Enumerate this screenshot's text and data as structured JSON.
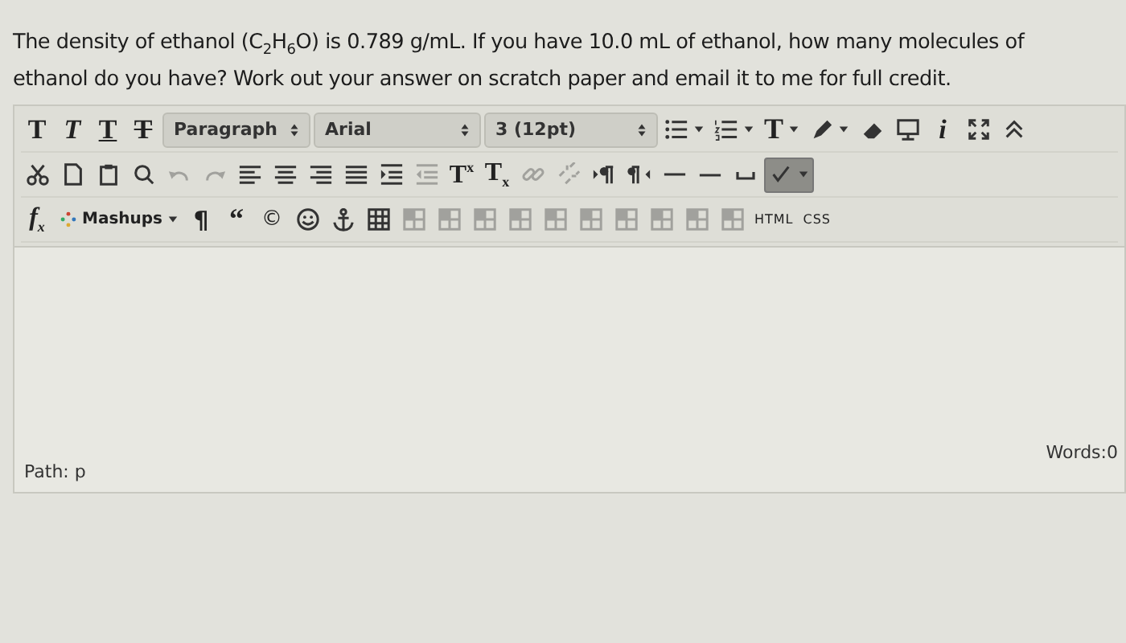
{
  "question": {
    "text": "The density of ethanol (C$_{2}$H$_{6}$O) is 0.789 g/mL.  If you have 10.0 mL of ethanol, how many molecules of ethanol do you have?  Work out your answer on scratch paper and email it to me for full credit."
  },
  "toolbar": {
    "rows": [
      {
        "items": [
          {
            "kind": "bold",
            "label": "T",
            "disabled": false,
            "menu": false
          },
          {
            "kind": "italic",
            "label": "T",
            "disabled": false,
            "menu": false
          },
          {
            "kind": "underline",
            "label": "T",
            "disabled": false,
            "menu": false
          },
          {
            "kind": "strikethrough",
            "label": "T",
            "disabled": false,
            "menu": false
          },
          {
            "kind": "select",
            "label": "Paragraph",
            "disabled": false,
            "menu": false
          },
          {
            "kind": "select",
            "label": "Arial",
            "disabled": false,
            "menu": false
          },
          {
            "kind": "select",
            "label": "3 (12pt)",
            "disabled": false,
            "menu": false
          },
          {
            "kind": "bullet-list",
            "disabled": false,
            "menu": true
          },
          {
            "kind": "numbered-list",
            "disabled": false,
            "menu": true
          },
          {
            "kind": "text-color",
            "label": "T",
            "disabled": false,
            "menu": true
          },
          {
            "kind": "highlighter",
            "disabled": false,
            "menu": true
          },
          {
            "kind": "eraser",
            "disabled": false,
            "menu": false
          },
          {
            "kind": "monitor",
            "disabled": false,
            "menu": false
          },
          {
            "kind": "info",
            "label": "i",
            "disabled": false,
            "menu": false
          },
          {
            "kind": "fullscreen",
            "disabled": false,
            "menu": false
          },
          {
            "kind": "collapse",
            "disabled": false,
            "menu": false
          }
        ]
      },
      {
        "items": [
          {
            "kind": "scissors",
            "disabled": false,
            "menu": false
          },
          {
            "kind": "page",
            "disabled": false,
            "menu": false
          },
          {
            "kind": "clipboard",
            "disabled": false,
            "menu": false
          },
          {
            "kind": "search",
            "disabled": false,
            "menu": false
          },
          {
            "kind": "undo",
            "disabled": true,
            "menu": false
          },
          {
            "kind": "redo",
            "disabled": true,
            "menu": false
          },
          {
            "kind": "align-left",
            "disabled": false,
            "menu": false
          },
          {
            "kind": "align-center",
            "disabled": false,
            "menu": false
          },
          {
            "kind": "align-right",
            "disabled": false,
            "menu": false
          },
          {
            "kind": "align-justify",
            "disabled": false,
            "menu": false
          },
          {
            "kind": "indent",
            "disabled": false,
            "menu": false
          },
          {
            "kind": "outdent",
            "disabled": true,
            "menu": false
          },
          {
            "kind": "superscript",
            "label": "T$^{x}$",
            "disabled": false,
            "menu": false
          },
          {
            "kind": "subscript",
            "label": "T$_{x}$",
            "disabled": false,
            "menu": false
          },
          {
            "kind": "link",
            "disabled": true,
            "menu": false
          },
          {
            "kind": "unlink",
            "disabled": true,
            "menu": false
          },
          {
            "kind": "ltr",
            "disabled": false,
            "menu": false
          },
          {
            "kind": "rtl",
            "disabled": false,
            "menu": false
          },
          {
            "kind": "rule-thin",
            "disabled": false,
            "menu": false
          },
          {
            "kind": "rule-thick",
            "disabled": false,
            "menu": false
          },
          {
            "kind": "space",
            "disabled": false,
            "menu": false
          },
          {
            "kind": "spellcheck",
            "disabled": false,
            "menu": true,
            "selected": true
          }
        ]
      },
      {
        "items": [
          {
            "kind": "formula",
            "label": "f$_{x}$",
            "disabled": false,
            "menu": false
          },
          {
            "kind": "mashups",
            "label": "Mashups",
            "disabled": false,
            "menu": true
          },
          {
            "kind": "pilcrow",
            "label": "¶",
            "disabled": false,
            "menu": false
          },
          {
            "kind": "quote",
            "label": "“",
            "disabled": false,
            "menu": false
          },
          {
            "kind": "copyright",
            "label": "©",
            "disabled": false,
            "menu": false
          },
          {
            "kind": "smiley",
            "disabled": false,
            "menu": false
          },
          {
            "kind": "anchor",
            "disabled": false,
            "menu": false
          },
          {
            "kind": "table",
            "disabled": false,
            "menu": false
          },
          {
            "kind": "table-cell",
            "disabled": true,
            "menu": false
          },
          {
            "kind": "table-cell",
            "disabled": true,
            "menu": false
          },
          {
            "kind": "table-cell",
            "disabled": true,
            "menu": false
          },
          {
            "kind": "table-cell",
            "disabled": true,
            "menu": false
          },
          {
            "kind": "table-cell",
            "disabled": true,
            "menu": false
          },
          {
            "kind": "table-cell",
            "disabled": true,
            "menu": false
          },
          {
            "kind": "table-cell",
            "disabled": true,
            "menu": false
          },
          {
            "kind": "table-cell",
            "disabled": true,
            "menu": false
          },
          {
            "kind": "table-cell",
            "disabled": true,
            "menu": false
          },
          {
            "kind": "table-cell",
            "disabled": true,
            "menu": false
          },
          {
            "kind": "code",
            "label": "HTML",
            "disabled": false,
            "menu": false
          },
          {
            "kind": "code",
            "label": "CSS",
            "disabled": false,
            "menu": false
          }
        ]
      }
    ]
  },
  "status_bar": {
    "path": "Path: p",
    "words": "Words:0"
  }
}
